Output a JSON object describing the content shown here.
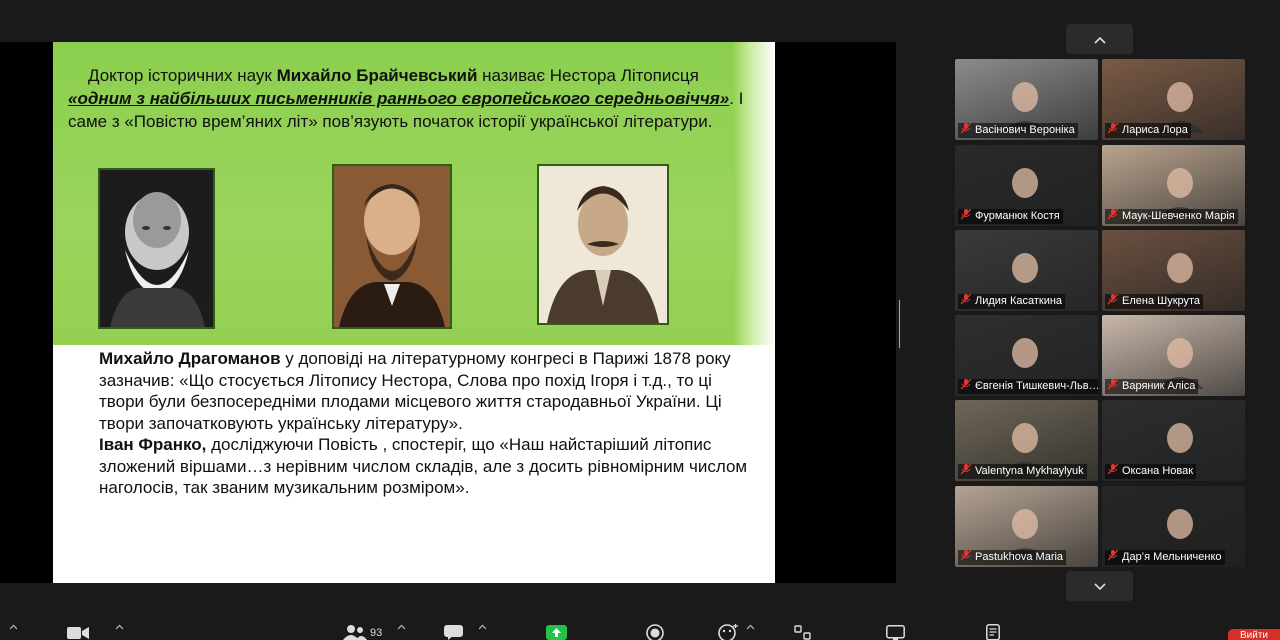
{
  "slide": {
    "intro_text": "Доктор історичних наук ",
    "intro_name": "Михайло Брайчевський",
    "intro_after_name": " називає Нестора Літописця ",
    "intro_quote": "«одним з найбільших письменників раннього європейського середньовіччя»",
    "intro_rest": ".  І саме з «Повістю врем’яних літ» пов’язують початок історії української літератури.",
    "para1_name": "Михайло Драгоманов",
    "para1_text": " у доповіді на літературному конгресі в Парижі 1878 року зазначив: «Що стосується Літопису Нестора, Слова про похід Ігоря  і т.д., то ці твори були безпосередніми плодами місцевого життя стародавньої України. Ці твори започатковують українську літературу».",
    "para2_name": "Іван Франко,",
    "para2_text": " досліджуючи Повість , спостеріг, що «Наш найстаріший літопис зложений віршами…з нерівним числом складів, але з досить рівномірним числом наголосів,  так званим музикальним розміром»."
  },
  "participants": [
    {
      "name": "Васінович Вероніка",
      "bg": "#8c8c8c"
    },
    {
      "name": "Лариса Лора",
      "bg": "#7a5a45"
    },
    {
      "name": "Фурманюк Костя",
      "bg": "#2a2a2a"
    },
    {
      "name": "Маук-Шевченко Марія",
      "bg": "#b9a48f"
    },
    {
      "name": "Лидия Касаткина",
      "bg": "#3a3a3a"
    },
    {
      "name": "Елена Шукрута",
      "bg": "#6b5040"
    },
    {
      "name": "Євгенія Тишкевич-Льв…",
      "bg": "#2e2e2e"
    },
    {
      "name": "Варяник Аліса",
      "bg": "#c9b8aa"
    },
    {
      "name": "Valentyna Mykhaylyuk",
      "bg": "#6e6658"
    },
    {
      "name": "Оксана Новак",
      "bg": "#2d2d2d"
    },
    {
      "name": "Pastukhova Maria",
      "bg": "#b4a393"
    },
    {
      "name": "Дар’я Мельниченко",
      "bg": "#262626"
    }
  ],
  "toolbar": {
    "participants_count": "93",
    "leave_label": "Вийти"
  },
  "colors": {
    "slide_green": "#8ccf4e",
    "mute_red": "#e8342a",
    "share_green": "#23c24b",
    "leave_red": "#d93025"
  }
}
